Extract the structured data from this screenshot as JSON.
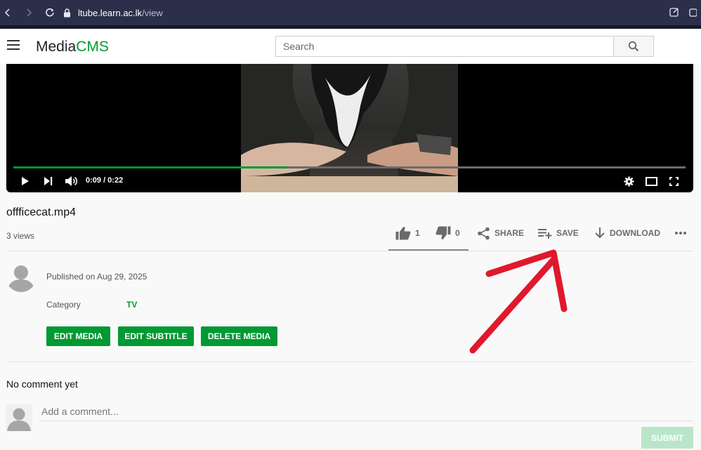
{
  "browser": {
    "url_host": "ltube.learn.ac.lk",
    "url_path": "/view",
    "icons": [
      "back-icon",
      "forward-icon",
      "reload-icon",
      "lock-icon",
      "edit-page-icon"
    ]
  },
  "header": {
    "logo_media": "Media",
    "logo_cms": "CMS",
    "search_placeholder": "Search",
    "brand_color": "#009933"
  },
  "player": {
    "current_time": "0:09",
    "duration": "0:22",
    "time_display": "0:09 / 0:22",
    "progress_fraction": 0.409,
    "icons": [
      "play-icon",
      "next-icon",
      "volume-icon",
      "settings-icon",
      "theater-mode-icon",
      "fullscreen-icon"
    ]
  },
  "media": {
    "title": "offficecat.mp4",
    "views": "3 views",
    "likes": "1",
    "dislikes": "0",
    "share_label": "SHARE",
    "save_label": "SAVE",
    "download_label": "DOWNLOAD"
  },
  "meta": {
    "published": "Published on Aug 29, 2025",
    "category_label": "Category",
    "category_value": "TV",
    "edit_media": "EDIT MEDIA",
    "edit_subtitle": "EDIT SUBTITLE",
    "delete_media": "DELETE MEDIA"
  },
  "comments": {
    "empty_text": "No comment yet",
    "placeholder": "Add a comment...",
    "submit_label": "SUBMIT"
  },
  "annotation": {
    "arrow_color": "#e0182d"
  }
}
